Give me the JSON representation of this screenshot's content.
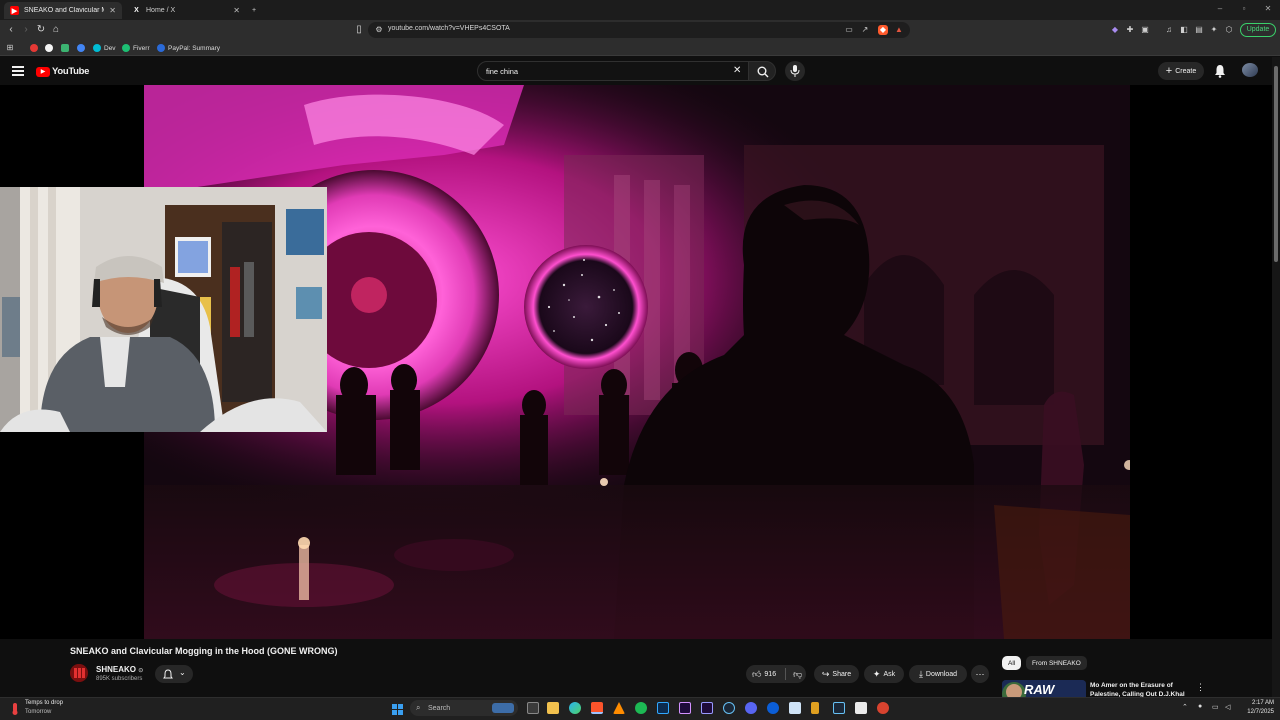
{
  "browser": {
    "tabs": [
      {
        "label": "SNEAKO and Clavicular Mogg",
        "icon": "youtube-icon",
        "active": true
      },
      {
        "label": "Home / X",
        "icon": "x-icon",
        "active": false
      }
    ],
    "url": "youtube.com/watch?v=VHEPs4CSOTA",
    "update_label": "Update",
    "bookmarks": [
      {
        "label": "",
        "color": "#e53935"
      },
      {
        "label": "",
        "color": "#ffffff"
      },
      {
        "label": "",
        "color": "#3cb371"
      },
      {
        "label": "",
        "color": "#4285f4"
      },
      {
        "label": "Dev",
        "color": "#00bcd4"
      },
      {
        "label": "Fiverr",
        "color": "#1dbf73"
      },
      {
        "label": "PayPal: Summary",
        "color": "#2a6ad8"
      }
    ]
  },
  "youtube": {
    "logo_text": "YouTube",
    "search_value": "fine china",
    "create_label": "Create",
    "video": {
      "title": "SNEAKO and Clavicular Mogging in the Hood (GONE WRONG)",
      "channel": "SHNEAKO",
      "subscribers": "895K subscribers",
      "likes": "916",
      "share_label": "Share",
      "ask_label": "Ask",
      "download_label": "Download"
    },
    "chips": {
      "all": "All",
      "from": "From SHNEAKO"
    },
    "recommendation": {
      "title": "Mo Amer on the Erasure of Palestine, Calling Out D.J.Khal",
      "thumb_text": "RAW"
    }
  },
  "taskbar": {
    "weather_line1": "Temps to drop",
    "weather_line2": "Tomorrow",
    "search_placeholder": "Search",
    "time": "2:17 AM",
    "date": "12/7/2025"
  },
  "colors": {
    "accent_red": "#ff0000",
    "yt_bg": "#0f0f0f",
    "neon_pink": "#ff2fbf"
  }
}
